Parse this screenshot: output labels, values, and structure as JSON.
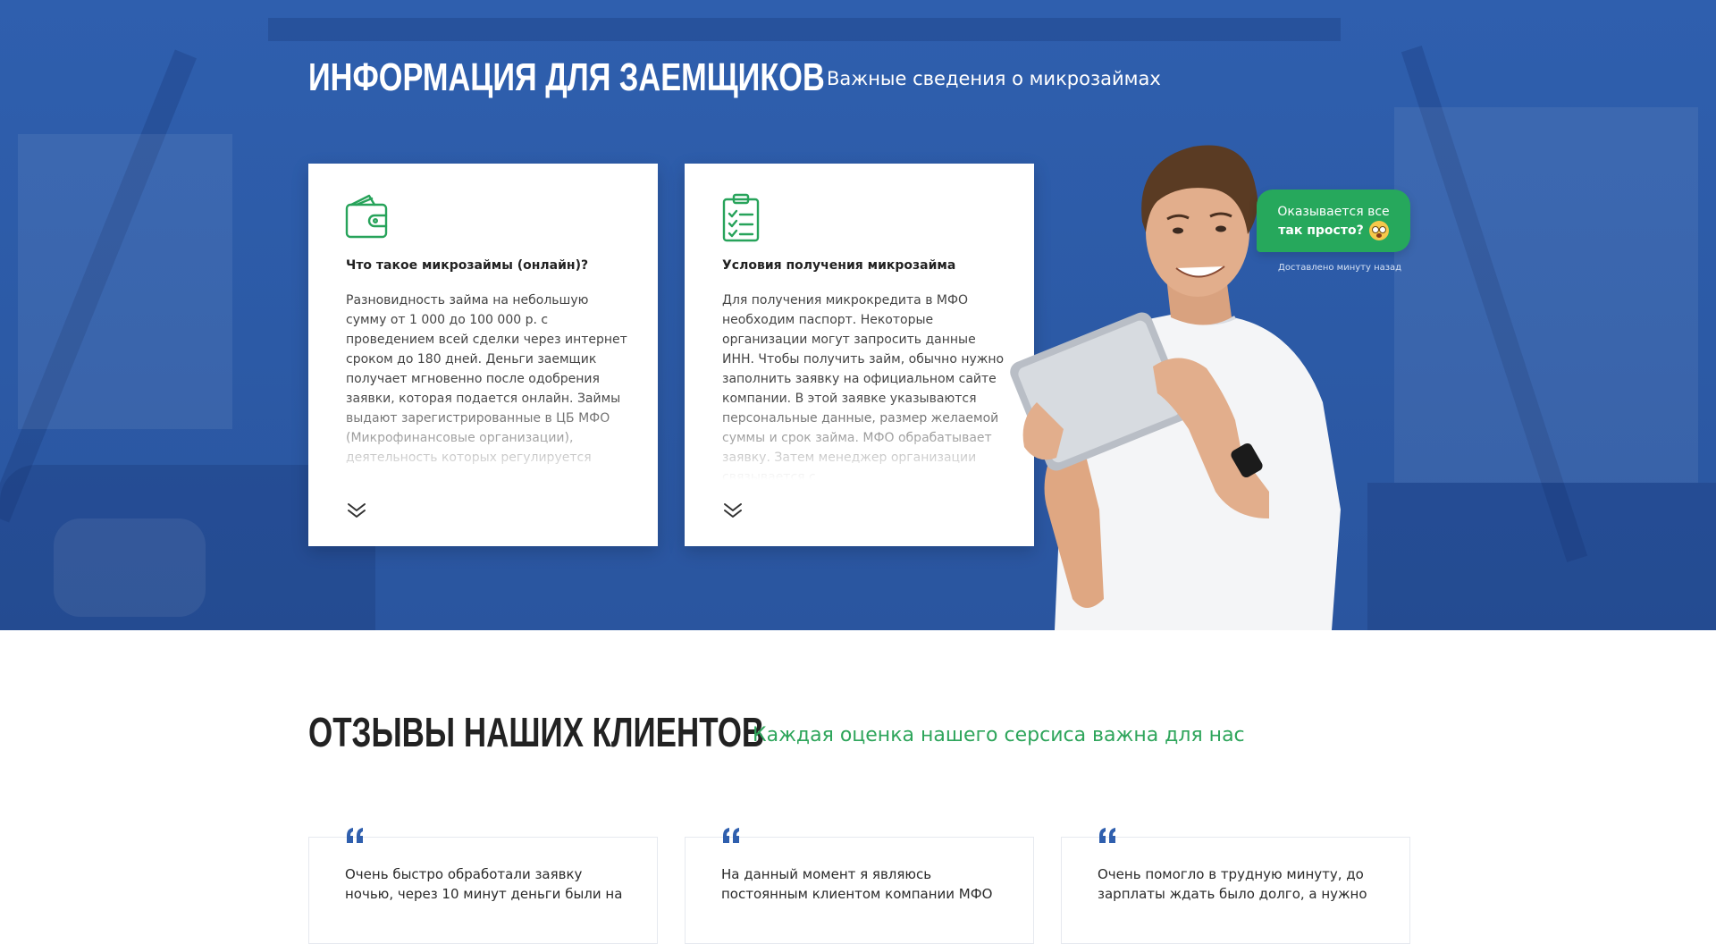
{
  "hero": {
    "title": "ИНФОРМАЦИЯ ДЛЯ ЗАЕМЩИКОВ",
    "subtitle": "Важные сведения о микрозаймах",
    "cards": [
      {
        "icon": "wallet-icon",
        "title": "Что такое микрозаймы (онлайн)?",
        "text": "Разновидность займа на небольшую сумму от 1 000 до 100 000 р. с проведением всей сделки через интернет сроком до 180 дней. Деньги заемщик получает мгновенно после одобрения заявки, которая подается онлайн. Займы выдают зарегистрированные в ЦБ МФО (Микрофинансовые организации), деятельность которых регулируется"
      },
      {
        "icon": "clipboard-checklist-icon",
        "title": "Условия получения микрозайма",
        "text": "Для получения микрокредита в МФО необходим паспорт. Некоторые организации могут запросить данные ИНН. Чтобы получить займ, обычно нужно заполнить заявку на официальном сайте компании. В этой заявке указываются персональные данные, размер желаемой суммы и срок займа. МФО обрабатывает заявку. Затем менеджер организации связывается с"
      }
    ],
    "bubble": {
      "line1": "Оказывается все",
      "line2": "так просто?",
      "status": "Доставлено минуту назад"
    }
  },
  "reviews": {
    "title": "ОТЗЫВЫ НАШИХ КЛИЕНТОВ",
    "subtitle": "Каждая оценка нашего серсиса важна для нас",
    "items": [
      {
        "text": "Очень быстро обработали заявку ночью, через 10 минут деньги были на"
      },
      {
        "text": "На данный момент я являюсь постоянным клиентом компании МФО"
      },
      {
        "text": "Очень помогло в трудную минуту, до зарплаты ждать было долго, а нужно"
      }
    ]
  },
  "colors": {
    "hero_blue": "#2f5fae",
    "accent_green": "#26a85c",
    "quote_blue": "#2f5fae"
  }
}
